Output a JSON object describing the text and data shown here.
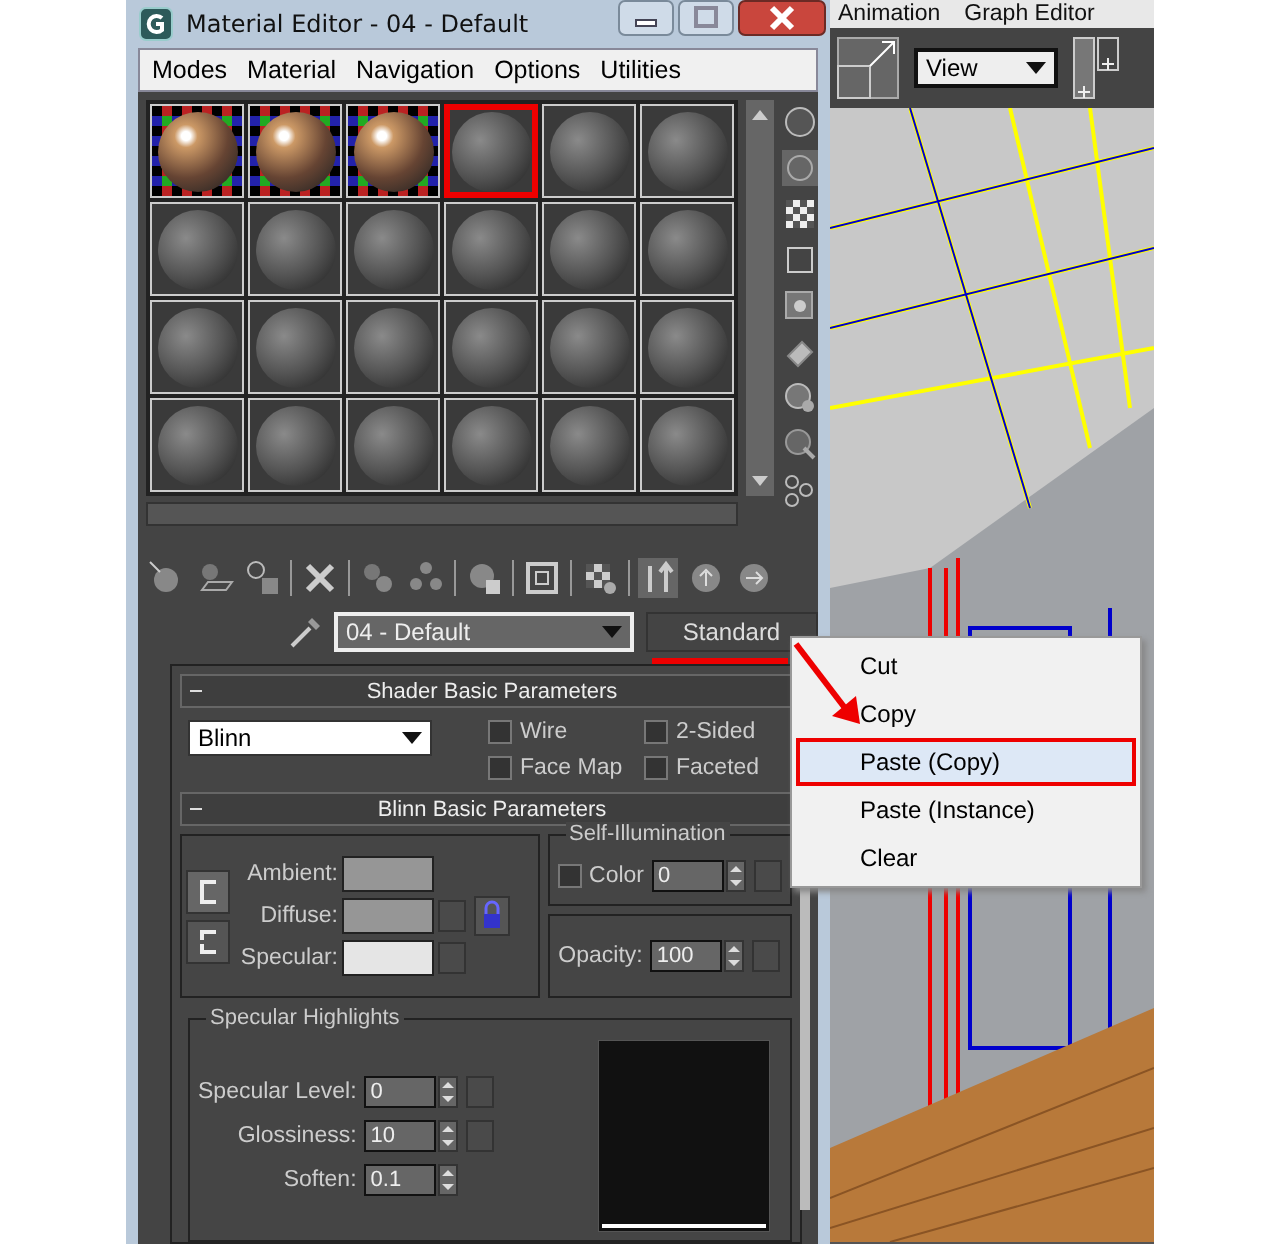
{
  "window": {
    "title": "Material Editor - 04 - Default"
  },
  "menubar": [
    "Modes",
    "Material",
    "Navigation",
    "Options",
    "Utilities"
  ],
  "slots": [
    {
      "kind": "checker",
      "selected": false
    },
    {
      "kind": "checker",
      "selected": false
    },
    {
      "kind": "checker",
      "selected": false
    },
    {
      "kind": "plain",
      "selected": true
    },
    {
      "kind": "plain",
      "selected": false
    },
    {
      "kind": "plain",
      "selected": false
    },
    {
      "kind": "plain",
      "selected": false
    },
    {
      "kind": "plain",
      "selected": false
    },
    {
      "kind": "plain",
      "selected": false
    },
    {
      "kind": "plain",
      "selected": false
    },
    {
      "kind": "plain",
      "selected": false
    },
    {
      "kind": "plain",
      "selected": false
    },
    {
      "kind": "plain",
      "selected": false
    },
    {
      "kind": "plain",
      "selected": false
    },
    {
      "kind": "plain",
      "selected": false
    },
    {
      "kind": "plain",
      "selected": false
    },
    {
      "kind": "plain",
      "selected": false
    },
    {
      "kind": "plain",
      "selected": false
    },
    {
      "kind": "plain",
      "selected": false
    },
    {
      "kind": "plain",
      "selected": false
    },
    {
      "kind": "plain",
      "selected": false
    },
    {
      "kind": "plain",
      "selected": false
    },
    {
      "kind": "plain",
      "selected": false
    },
    {
      "kind": "plain",
      "selected": false
    }
  ],
  "material_name": "04 - Default",
  "material_type": "Standard",
  "shader_rollout": {
    "title": "Shader Basic Parameters",
    "shader": "Blinn",
    "options": [
      {
        "label": "Wire",
        "checked": false
      },
      {
        "label": "2-Sided",
        "checked": false
      },
      {
        "label": "Face Map",
        "checked": false
      },
      {
        "label": "Faceted",
        "checked": false
      }
    ]
  },
  "blinn_rollout": {
    "title": "Blinn Basic Parameters",
    "colors": [
      {
        "label": "Ambient:",
        "color": "#969696"
      },
      {
        "label": "Diffuse:",
        "color": "#969696"
      },
      {
        "label": "Specular:",
        "color": "#e5e5e5"
      }
    ],
    "self_illumination": {
      "title": "Self-Illumination",
      "label": "Color",
      "checked": false,
      "value": "0"
    },
    "opacity": {
      "label": "Opacity:",
      "value": "100"
    },
    "specular_highlights": {
      "title": "Specular Highlights",
      "fields": [
        {
          "label": "Specular Level:",
          "value": "0"
        },
        {
          "label": "Glossiness:",
          "value": "10"
        },
        {
          "label": "Soften:",
          "value": "0.1"
        }
      ]
    }
  },
  "context_menu": [
    {
      "label": "Cut",
      "selected": false
    },
    {
      "label": "Copy",
      "selected": false
    },
    {
      "label": "Paste (Copy)",
      "selected": true
    },
    {
      "label": "Paste (Instance)",
      "selected": false
    },
    {
      "label": "Clear",
      "selected": false
    }
  ],
  "background_app": {
    "menubar": [
      "Animation",
      "Graph Editor"
    ],
    "view_dropdown": "View"
  }
}
